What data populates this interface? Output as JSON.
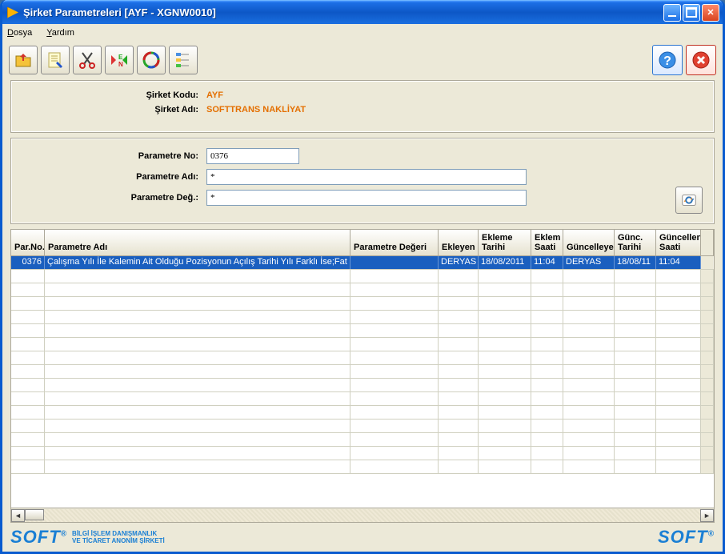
{
  "title": "Şirket Parametreleri [AYF - XGNW0010]",
  "menu": {
    "file": "Dosya",
    "help": "Yardım"
  },
  "toolbar_icons": {
    "open": "open-icon",
    "notes": "notes-icon",
    "cut": "cut-icon",
    "lang": "lang-en-icon",
    "recycle": "recycle-icon",
    "tree": "tree-icon",
    "help": "help-icon",
    "cancel": "cancel-icon"
  },
  "company": {
    "code_label": "Şirket Kodu:",
    "code": "AYF",
    "name_label": "Şirket Adı:",
    "name": "SOFTTRANS NAKLİYAT"
  },
  "filter": {
    "no_label": "Parametre No:",
    "no": "0376",
    "ad_label": "Parametre Adı:",
    "ad": "*",
    "deg_label": "Parametre Değ.:",
    "deg": "*",
    "refresh": "refresh"
  },
  "grid": {
    "headers": {
      "parno": "Par.No.",
      "name": "Parametre Adı",
      "val": "Parametre Değeri",
      "ekleyen": "Ekleyen",
      "etarih": "Ekleme Tarihi",
      "esaat": "Eklem Saati",
      "gunc": "Güncelleyen",
      "gtarih": "Günc. Tarihi",
      "gsaat": "Güncellen Saati"
    },
    "rows": [
      {
        "parno": "0376",
        "name": "Çalışma Yılı İle Kalemin Ait Olduğu Pozisyonun Açılış Tarihi Yılı Farklı İse;Fat",
        "val": "",
        "ekleyen": "DERYAS",
        "etarih": "18/08/2011",
        "esaat": "11:04",
        "gunc": "DERYAS",
        "gtarih": "18/08/11",
        "gsaat": "11:04",
        "selected": true
      }
    ],
    "blank_rows": 15
  },
  "footer": {
    "brand": "SOFT",
    "sub1": "BİLGİ İŞLEM DANIŞMANLIK",
    "sub2": "VE TİCARET ANONİM ŞİRKETİ"
  }
}
